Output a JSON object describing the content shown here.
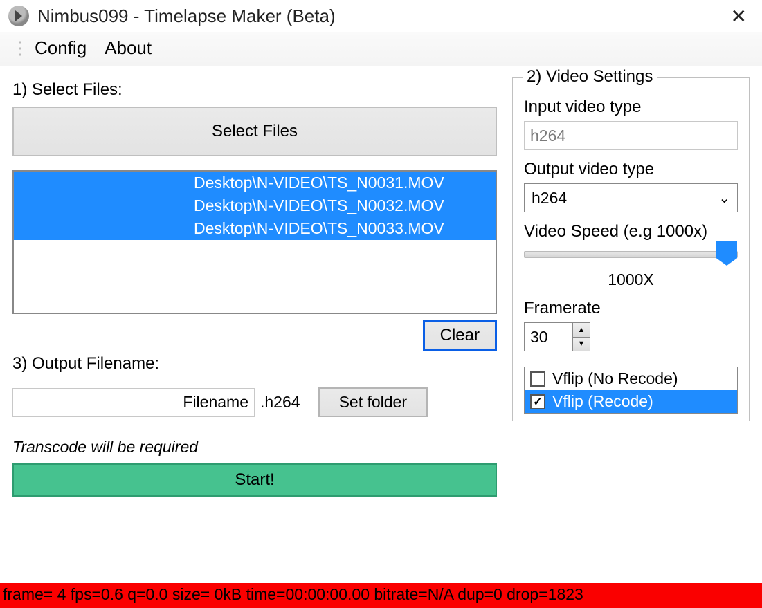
{
  "window": {
    "title": "Nimbus099 - Timelapse Maker (Beta)"
  },
  "menu": {
    "config": "Config",
    "about": "About"
  },
  "select_files": {
    "heading": "1) Select Files:",
    "button": "Select Files",
    "clear": "Clear",
    "entries": [
      "Desktop\\N-VIDEO\\TS_N0031.MOV",
      "Desktop\\N-VIDEO\\TS_N0032.MOV",
      "Desktop\\N-VIDEO\\TS_N0033.MOV"
    ]
  },
  "output": {
    "heading": "3) Output Filename:",
    "filename": "Filename",
    "ext": ".h264",
    "set_folder": "Set folder",
    "note": "Transcode will be required",
    "start": "Start!"
  },
  "settings": {
    "legend": "2) Video Settings",
    "input_type_label": "Input video type",
    "input_type_value": "h264",
    "output_type_label": "Output video type",
    "output_type_value": "h264",
    "speed_label": "Video Speed (e.g 1000x)",
    "speed_value": "1000X",
    "framerate_label": "Framerate",
    "framerate_value": "30",
    "vflip_norecode": "Vflip (No Recode)",
    "vflip_recode": "Vflip (Recode)"
  },
  "status": "frame=    4 fps=0.6 q=0.0 size=       0kB time=00:00:00.00 bitrate=N/A dup=0 drop=1823"
}
